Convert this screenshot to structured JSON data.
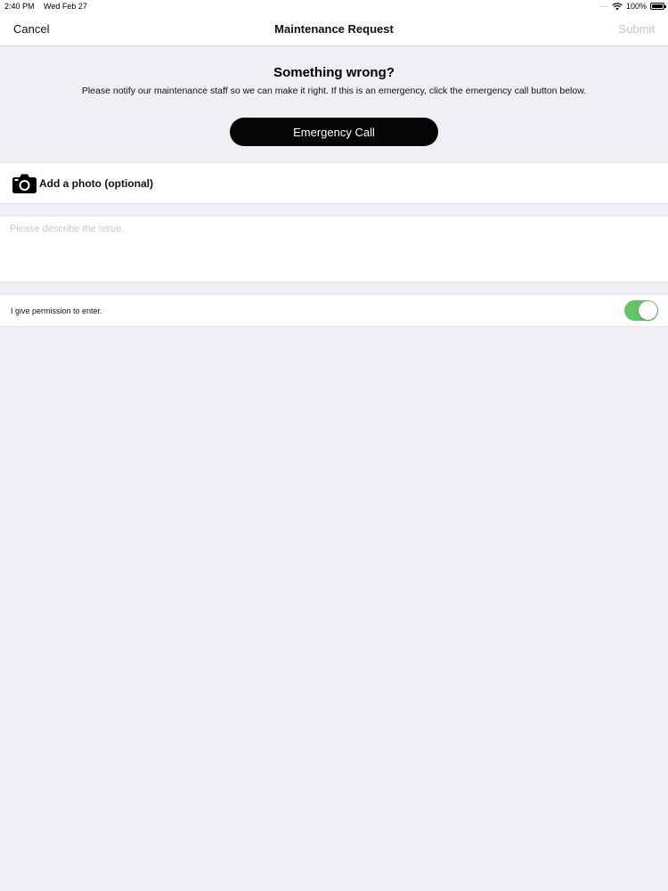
{
  "status_bar": {
    "time": "2:40 PM",
    "date": "Wed Feb 27",
    "signal": ".....",
    "wifi_icon": "wifi-icon",
    "battery_percent": "100%",
    "battery_level": 1.0
  },
  "nav": {
    "cancel_label": "Cancel",
    "title": "Maintenance Request",
    "submit_label": "Submit",
    "submit_enabled": false
  },
  "hero": {
    "heading": "Something wrong?",
    "text": "Please notify our maintenance staff so we can make it right. If this is an emergency, click the emergency call button below.",
    "emergency_button_label": "Emergency Call"
  },
  "photo": {
    "icon": "camera-icon",
    "label": "Add a photo (optional)"
  },
  "description": {
    "placeholder": "Please describe the issue.",
    "value": ""
  },
  "permission": {
    "label": "I give permission to enter.",
    "enabled": true
  },
  "colors": {
    "background": "#f0eff4",
    "toggle_on": "#65c466",
    "button": "#050505",
    "disabled_text": "#c4c4c8"
  }
}
